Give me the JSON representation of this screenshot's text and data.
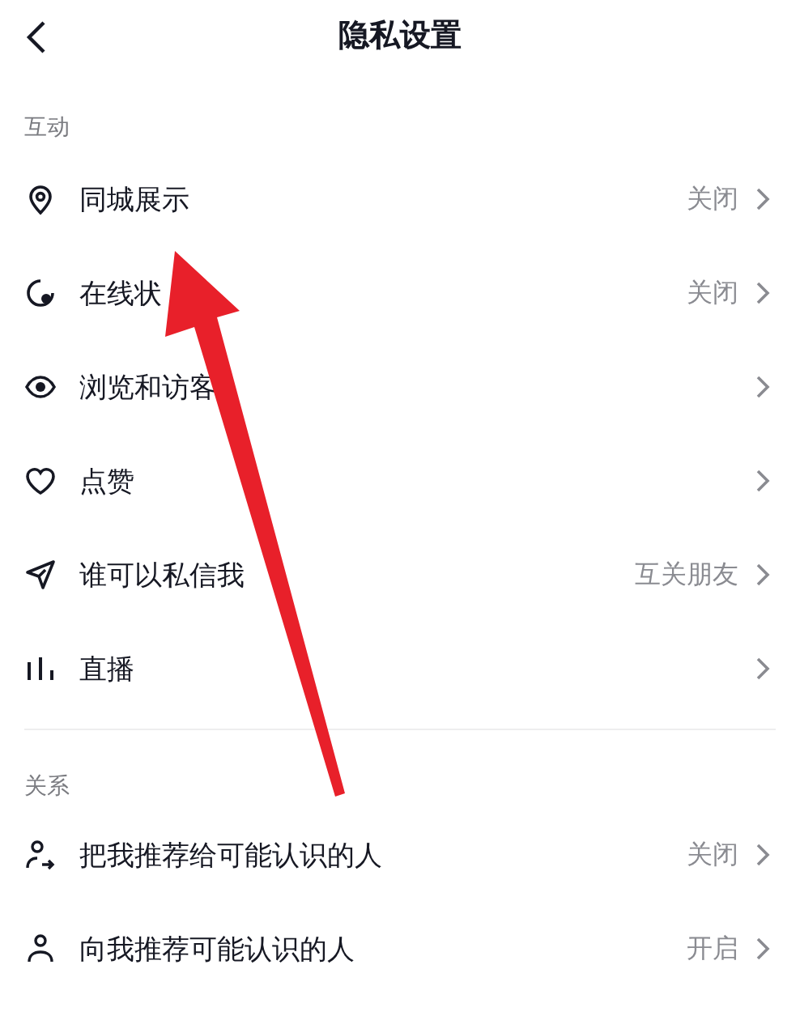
{
  "header": {
    "title": "隐私设置"
  },
  "sections": [
    {
      "title": "互动",
      "rows": [
        {
          "kind": "pin",
          "label": "同城展示",
          "value": "关闭"
        },
        {
          "kind": "status",
          "label": "在线状",
          "value": "关闭"
        },
        {
          "kind": "eye",
          "label": "浏览和访客"
        },
        {
          "kind": "heart",
          "label": "点赞"
        },
        {
          "kind": "send",
          "label": "谁可以私信我",
          "value": "互关朋友"
        },
        {
          "kind": "bars",
          "label": "直播"
        }
      ]
    },
    {
      "title": "关系",
      "rows": [
        {
          "kind": "person-share",
          "label": "把我推荐给可能认识的人",
          "value": "关闭"
        },
        {
          "kind": "person",
          "label": "向我推荐可能认识的人",
          "value": "开启"
        }
      ]
    }
  ]
}
